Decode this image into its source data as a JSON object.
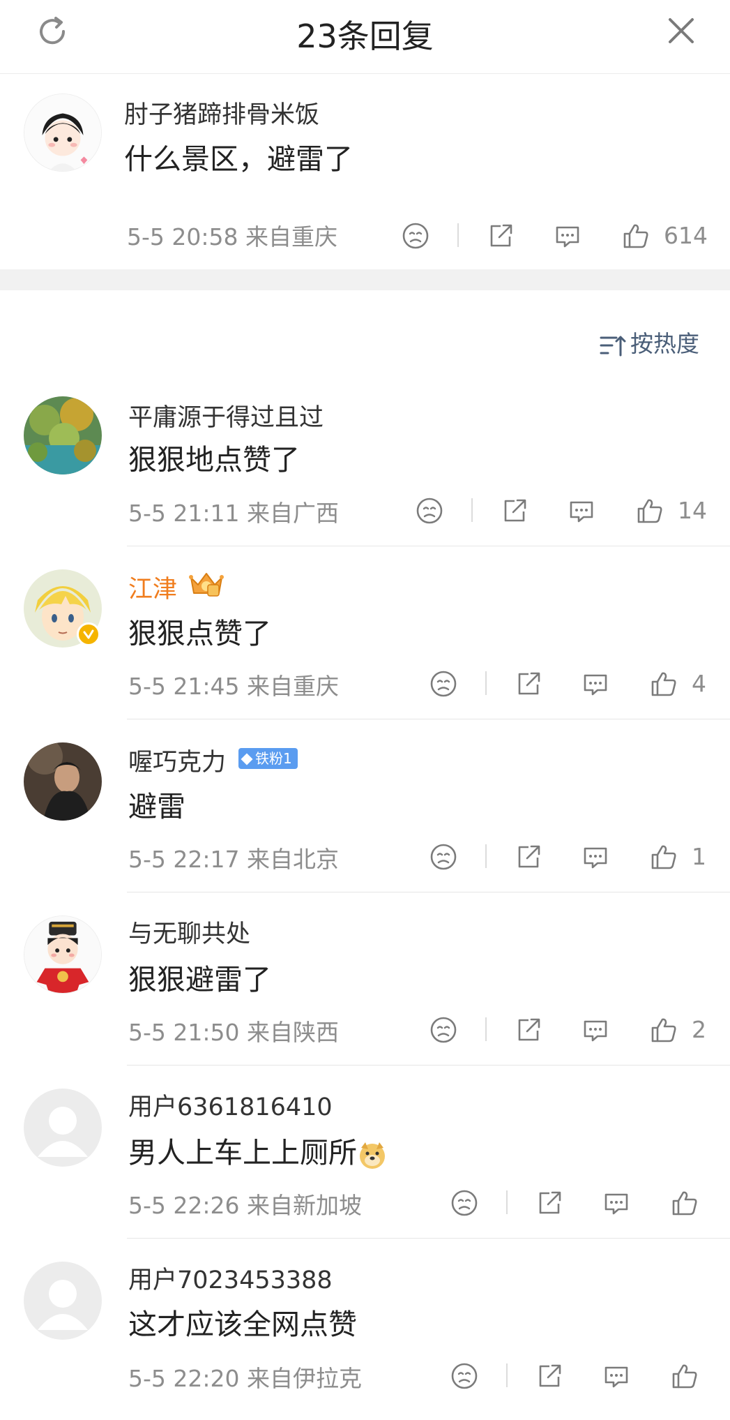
{
  "header": {
    "title": "23条回复"
  },
  "main_comment": {
    "name": "肘子猪蹄排骨米饭",
    "text": "什么景区，避雷了",
    "time": "5-5 20:58",
    "location": "来自重庆",
    "likes": "614"
  },
  "sort": {
    "label": "按热度"
  },
  "replies": [
    {
      "name": "平庸源于得过且过",
      "text": "狠狠地点赞了",
      "time": "5-5 21:11",
      "location": "来自广西",
      "likes": "14"
    },
    {
      "name": "江津",
      "text": "狠狠点赞了",
      "time": "5-5 21:45",
      "location": "来自重庆",
      "likes": "4"
    },
    {
      "name": "喔巧克力",
      "badge": "铁粉1",
      "text": "避雷",
      "time": "5-5 22:17",
      "location": "来自北京",
      "likes": "1"
    },
    {
      "name": "与无聊共处",
      "text": "狠狠避雷了",
      "time": "5-5 21:50",
      "location": "来自陕西",
      "likes": "2"
    },
    {
      "name": "用户6361816410",
      "text": "男人上车上上厕所",
      "time": "5-5 22:26",
      "location": "来自新加坡",
      "likes": ""
    },
    {
      "name": "用户7023453388",
      "text": "这才应该全网点赞",
      "time": "5-5 22:20",
      "location": "来自伊拉克",
      "likes": ""
    }
  ],
  "icons": {
    "refresh": "refresh-icon",
    "close": "close-icon",
    "dislike": "sad-face-icon",
    "share": "share-icon",
    "comment": "comment-icon",
    "like": "thumbs-up-icon",
    "sort": "sort-icon",
    "vip": "crown-badge-icon",
    "verified": "verified-icon",
    "fan": "diamond-icon",
    "emoji": "doge-emoji-icon"
  },
  "colors": {
    "vip_name": "#f07d1e",
    "meta": "#8d8d8d",
    "sort": "#4a5e78",
    "fan_badge": "#5a9cf0"
  }
}
